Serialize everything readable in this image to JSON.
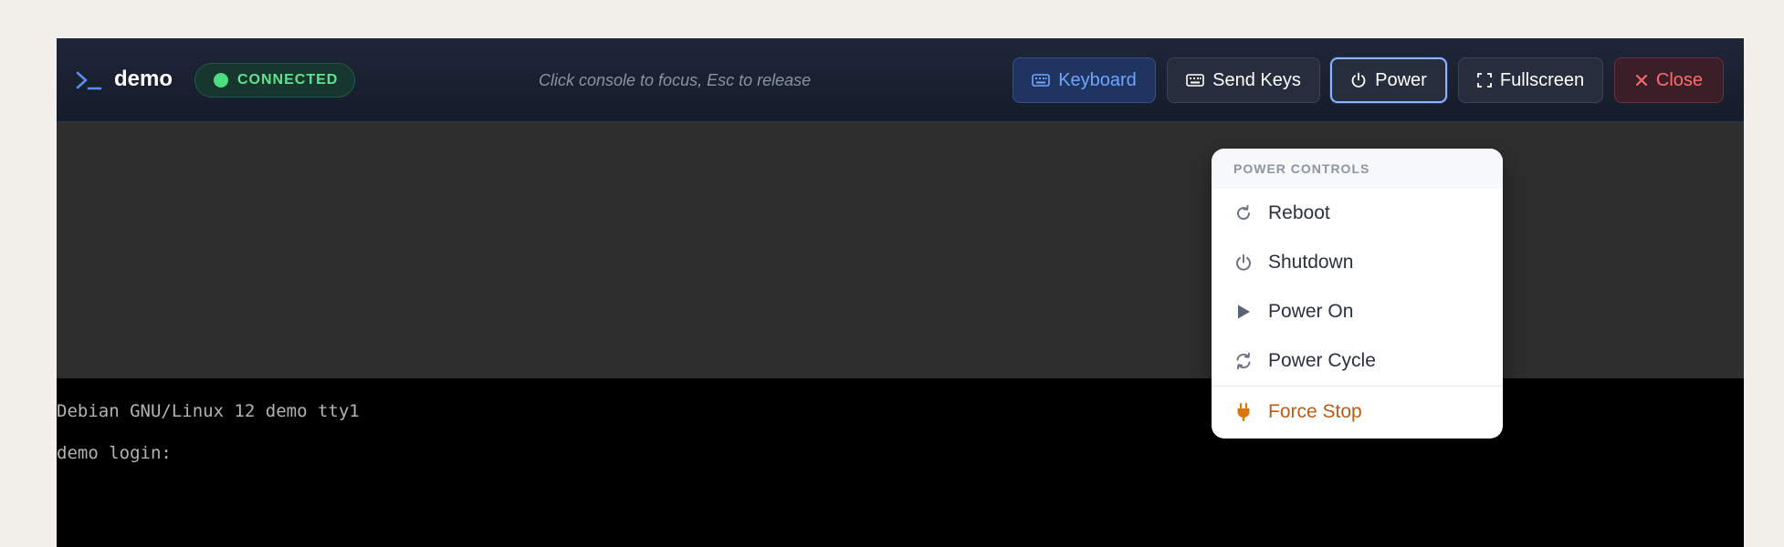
{
  "toolbar": {
    "vm_name": "demo",
    "status": "CONNECTED",
    "hint": "Click console to focus, Esc to release",
    "buttons": {
      "keyboard": "Keyboard",
      "send_keys": "Send Keys",
      "power": "Power",
      "fullscreen": "Fullscreen",
      "close": "Close"
    }
  },
  "console": {
    "lines": [
      "Debian GNU/Linux 12 demo tty1",
      "demo login:"
    ]
  },
  "power_menu": {
    "header": "POWER CONTROLS",
    "items": [
      {
        "label": "Reboot",
        "icon": "rotate-cw-icon"
      },
      {
        "label": "Shutdown",
        "icon": "power-icon"
      },
      {
        "label": "Power On",
        "icon": "play-icon"
      },
      {
        "label": "Power Cycle",
        "icon": "refresh-icon"
      },
      {
        "label": "Force Stop",
        "icon": "plug-icon"
      }
    ]
  },
  "colors": {
    "accent": "#70a4ff",
    "connected": "#4ade80",
    "danger": "#ff6b6b",
    "warning": "#c05a10"
  }
}
